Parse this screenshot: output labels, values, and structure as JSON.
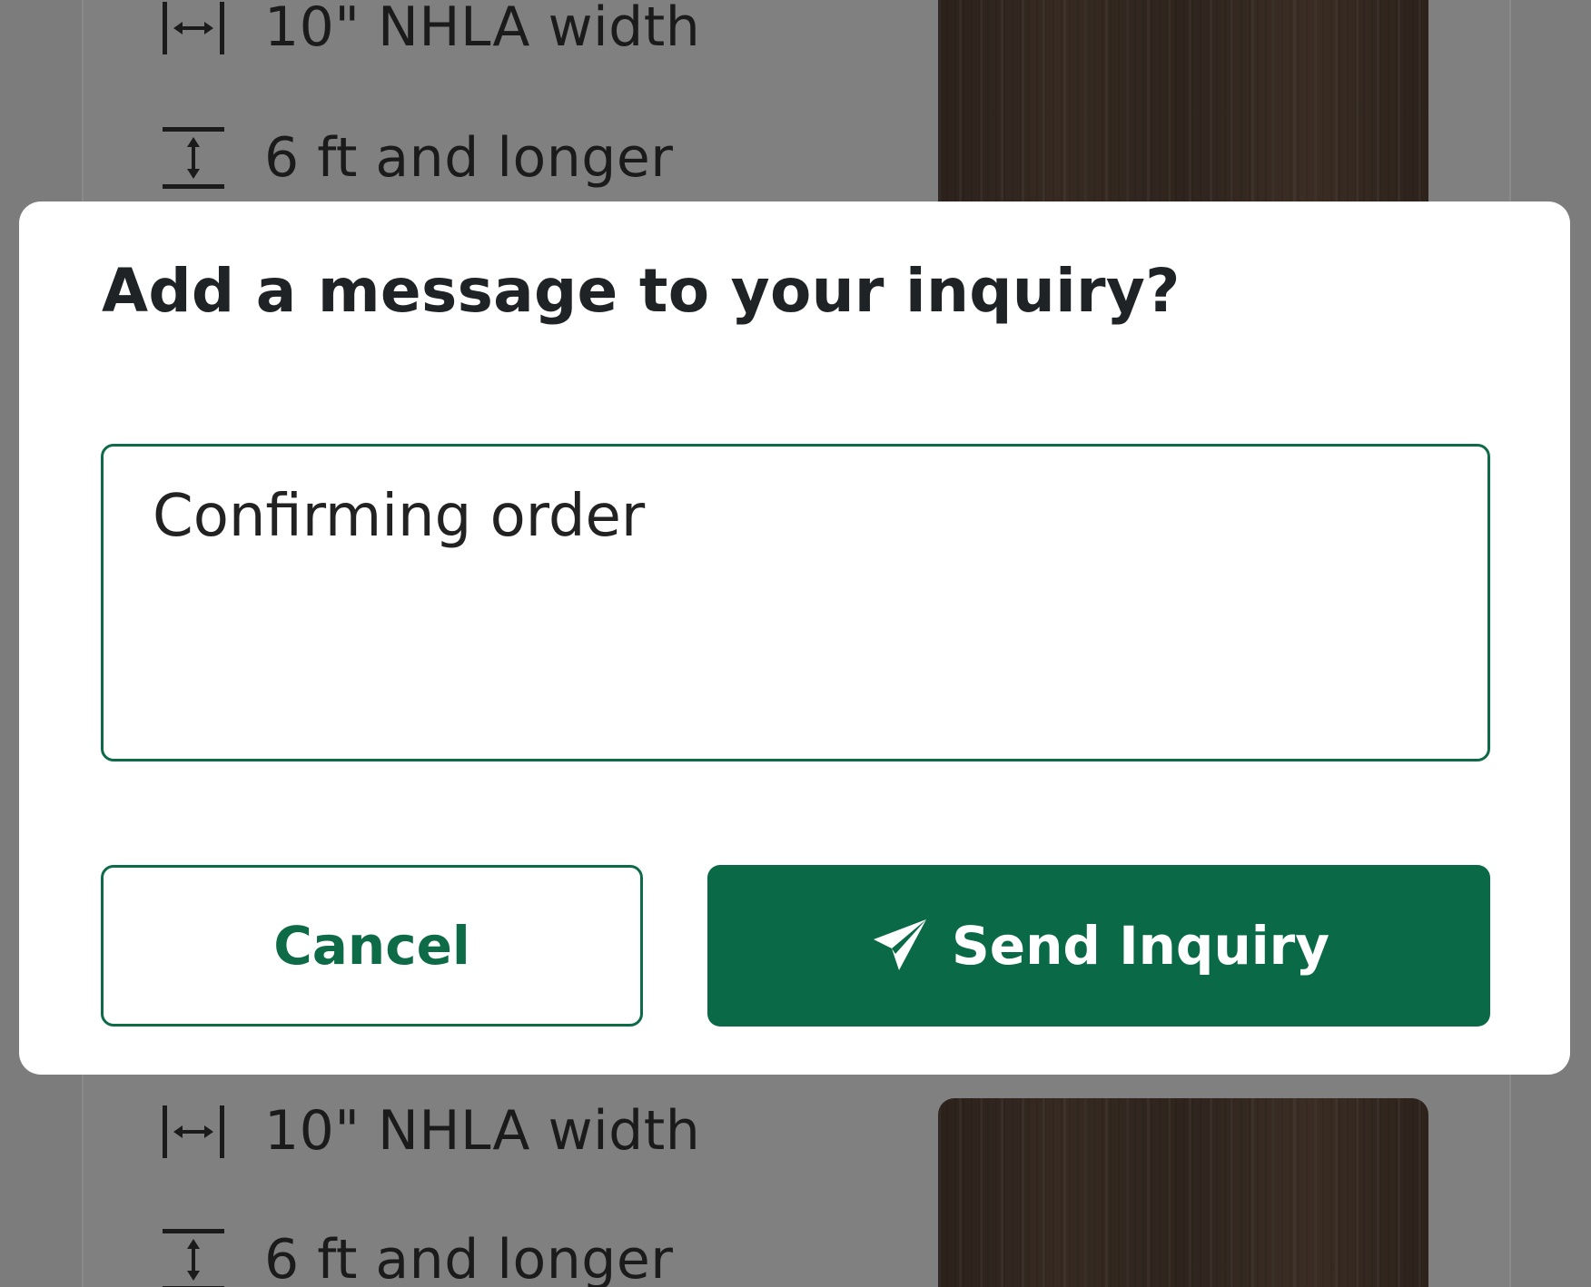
{
  "colors": {
    "accent": "#0a6a47",
    "overlay": "#7c7c7c",
    "text": "#1f2326"
  },
  "background_listings": [
    {
      "width_spec": "10\" NHLA width",
      "length_spec": "6 ft and longer"
    },
    {
      "width_spec": "10\" NHLA width",
      "length_spec": "6 ft and longer"
    }
  ],
  "dialog": {
    "title": "Add a message to your inquiry?",
    "message_value": "Confirming order",
    "cancel_label": "Cancel",
    "send_label": "Send Inquiry",
    "send_icon": "paper-plane-icon"
  }
}
